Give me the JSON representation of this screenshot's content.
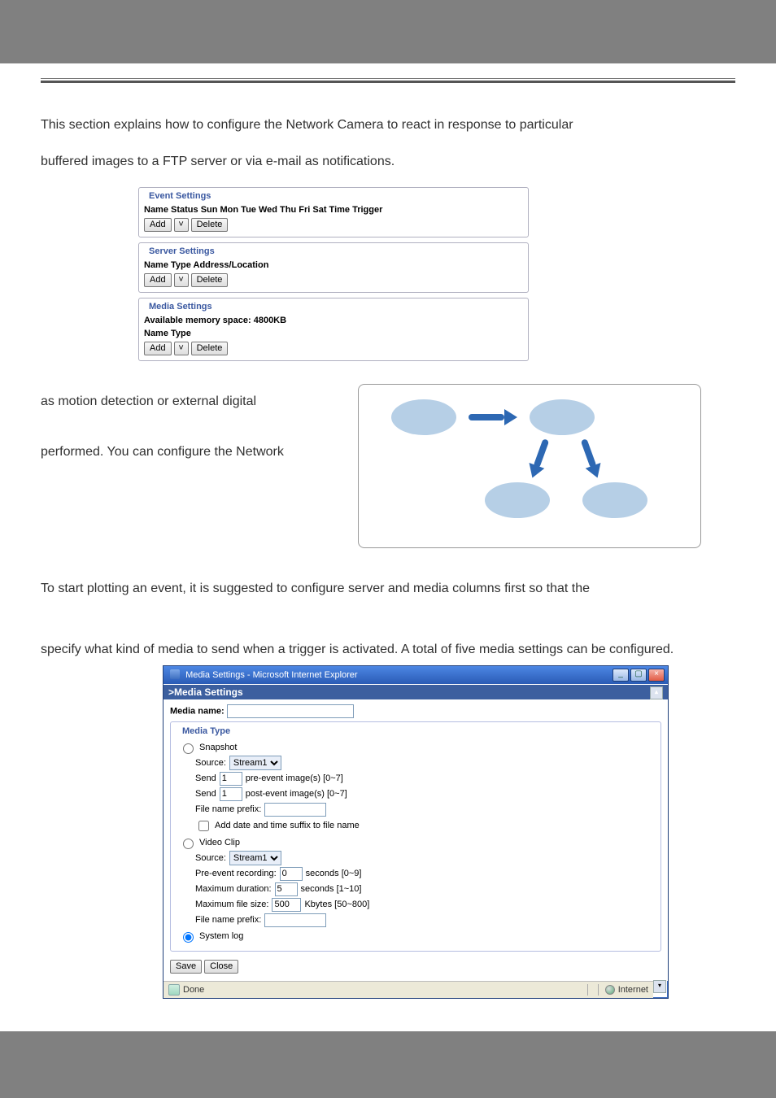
{
  "doc": {
    "intro_line1": "This section explains how to configure the Network Camera to react in response to particular",
    "intro_line2": "buffered images to a FTP server or via e-mail as notifications.",
    "mid_line1": "as motion detection or external digital",
    "mid_line2": "performed. You can configure the Network",
    "mid2": "To start plotting an event, it is suggested to configure server and media columns first so that the",
    "mid3": "specify what kind of media to send when a trigger is activated. A total of five media settings can be configured."
  },
  "panel": {
    "event": {
      "legend": "Event Settings",
      "header": "Name Status Sun Mon Tue Wed Thu Fri Sat Time Trigger",
      "add": "Add",
      "del": "Delete"
    },
    "server": {
      "legend": "Server Settings",
      "header": "Name Type Address/Location",
      "add": "Add",
      "del": "Delete"
    },
    "media": {
      "legend": "Media Settings",
      "mem": "Available memory space: 4800KB",
      "header": "Name Type",
      "add": "Add",
      "del": "Delete"
    }
  },
  "ie": {
    "title": "Media Settings - Microsoft Internet Explorer",
    "header": ">Media Settings",
    "media_name_label": "Media name:",
    "media_type_legend": "Media Type",
    "snapshot": {
      "label": "Snapshot",
      "source_label": "Source:",
      "source_value": "Stream1",
      "send_pre_label": "Send",
      "send_pre_value": "1",
      "send_pre_suffix": "pre-event image(s) [0~7]",
      "send_post_label": "Send",
      "send_post_value": "1",
      "send_post_suffix": "post-event image(s) [0~7]",
      "file_prefix_label": "File name prefix:",
      "add_date_label": "Add date and time suffix to file name"
    },
    "videoclip": {
      "label": "Video Clip",
      "source_label": "Source:",
      "source_value": "Stream1",
      "pre_rec_label": "Pre-event recording:",
      "pre_rec_value": "0",
      "pre_rec_suffix": "seconds [0~9]",
      "max_dur_label": "Maximum duration:",
      "max_dur_value": "5",
      "max_dur_suffix": "seconds [1~10]",
      "max_size_label": "Maximum file size:",
      "max_size_value": "500",
      "max_size_suffix": "Kbytes [50~800]",
      "file_prefix_label": "File name prefix:"
    },
    "systemlog_label": "System log",
    "save": "Save",
    "close": "Close",
    "status_done": "Done",
    "status_zone": "Internet"
  }
}
